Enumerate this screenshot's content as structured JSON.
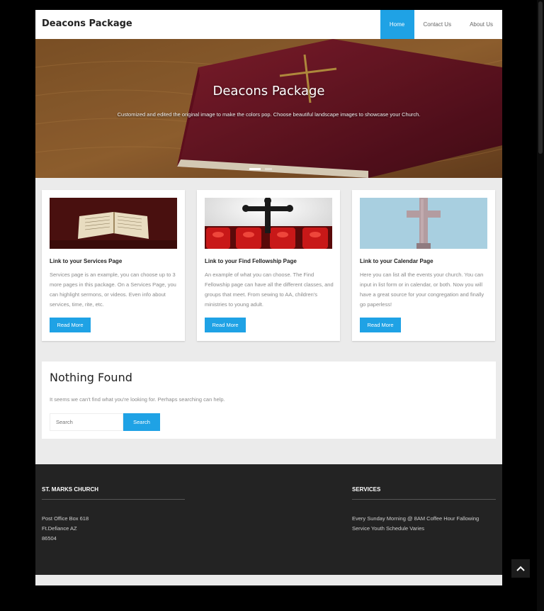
{
  "header": {
    "site_title": "Deacons Package",
    "nav": [
      {
        "label": "Home",
        "active": true
      },
      {
        "label": "Contact Us",
        "active": false
      },
      {
        "label": "About Us",
        "active": false
      }
    ]
  },
  "hero": {
    "title": "Deacons Package",
    "subtitle": "Customized and edited the original image to make the colors pop. Choose beautiful landscape images to showcase your Church."
  },
  "cards": [
    {
      "title": "Link to your Services Page",
      "text": "Services page is an example, you can choose up to 3 more pages in this package. On a Services Page, you can highlight sermons, or videos. Even info about services, time, rite, etc.",
      "button": "Read More"
    },
    {
      "title": "Link to your Find Fellowship Page",
      "text": "An example of what you can choose. The Find Fellowship page can have all the different classes, and groups that meet. From sewing to AA, children's ministries to young adult.",
      "button": "Read More"
    },
    {
      "title": "Link to your Calendar Page",
      "text": "Here you can list all the events your church. You can input in list form or in calendar, or both. Now you will have a great source for your congregation and finally go paperless!",
      "button": "Read More"
    }
  ],
  "nothing_found": {
    "title": "Nothing Found",
    "text": "It seems we can't find what you're looking for. Perhaps searching can help.",
    "search_placeholder": "Search",
    "search_button": "Search"
  },
  "footer": {
    "church": {
      "heading": "ST. MARKS CHURCH",
      "lines": [
        "Post Office Box 618",
        "Ft.Defiance AZ",
        "86504"
      ]
    },
    "services": {
      "heading": "SERVICES",
      "lines": [
        "Every Sunday Morning @ 8AM Coffee Hour Fallowing",
        "Service Youth Schedule Varies"
      ]
    }
  },
  "colors": {
    "accent": "#1fa2e5",
    "footer_bg": "#232323",
    "page_bg": "#ebebeb"
  },
  "icons": {
    "scroll_top": "chevron-up-icon"
  }
}
